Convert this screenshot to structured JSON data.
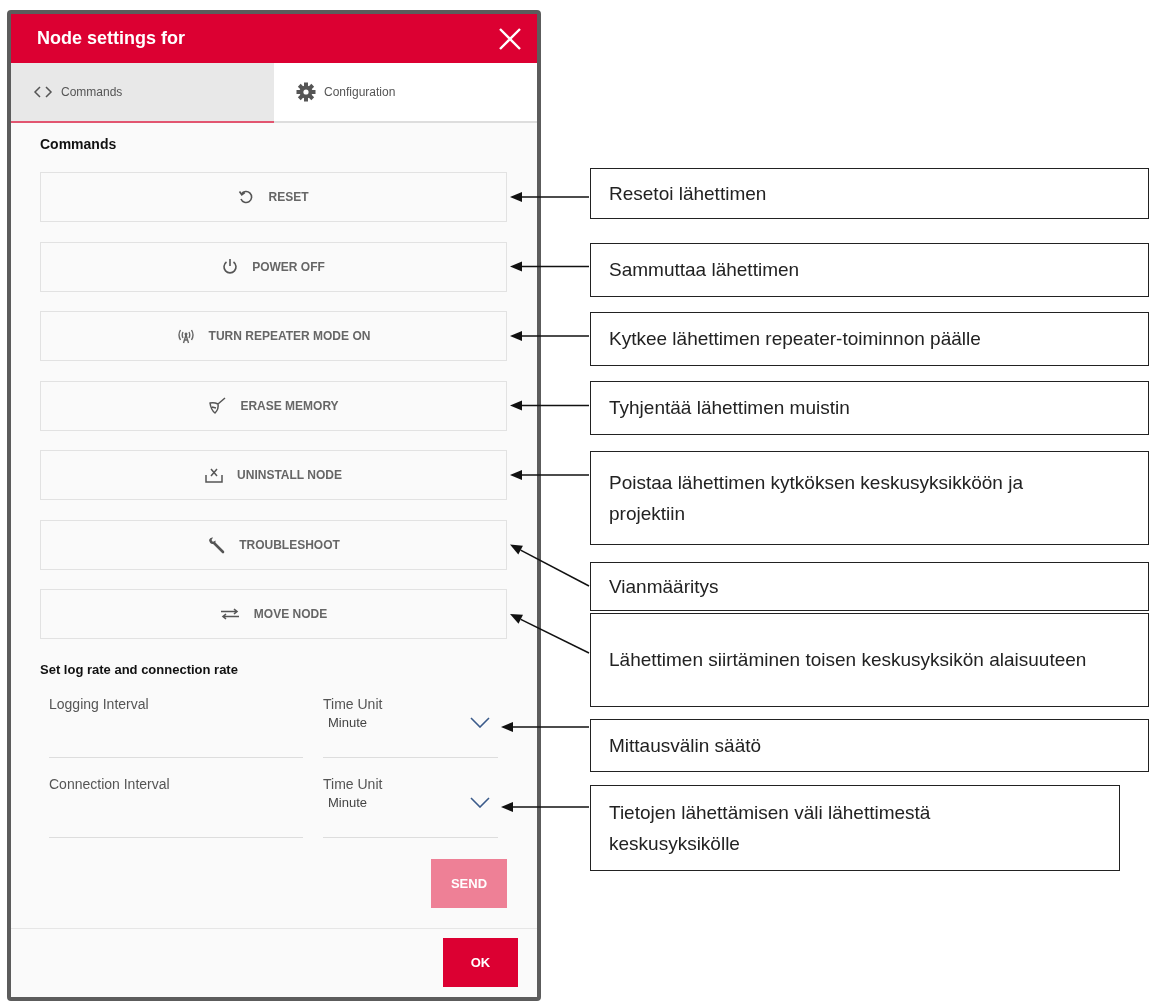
{
  "dialog": {
    "title": "Node settings for",
    "tabs": [
      {
        "label": "Commands",
        "kind": "code",
        "selected": true
      },
      {
        "label": "Configuration",
        "kind": "gear",
        "selected": false
      }
    ],
    "section_title": "Commands",
    "commands": [
      {
        "label": "RESET",
        "kind": "reset"
      },
      {
        "label": "POWER OFF",
        "kind": "power"
      },
      {
        "label": "TURN REPEATER MODE ON",
        "kind": "antenna"
      },
      {
        "label": "ERASE MEMORY",
        "kind": "erase"
      },
      {
        "label": "UNINSTALL NODE",
        "kind": "uninstall"
      },
      {
        "label": "TROUBLESHOOT",
        "kind": "wrench"
      },
      {
        "label": "MOVE NODE",
        "kind": "swap"
      }
    ],
    "rate_section_title": "Set log rate and connection rate",
    "intervals": [
      {
        "label": "Logging Interval",
        "unit_label": "Time Unit",
        "unit_value": "Minute"
      },
      {
        "label": "Connection Interval",
        "unit_label": "Time Unit",
        "unit_value": "Minute"
      }
    ],
    "send_button": {
      "label": "SEND",
      "disabled": true
    },
    "ok_button": {
      "label": "OK"
    }
  },
  "callouts": [
    {
      "text": "Resetoi lähettimen"
    },
    {
      "text": "Sammuttaa lähettimen"
    },
    {
      "text": "Kytkee lähettimen repeater-toiminnon päälle"
    },
    {
      "text": "Tyhjentää lähettimen muistin"
    },
    {
      "text": "Poistaa lähettimen kytköksen keskusyksikköön ja projektiin"
    },
    {
      "text": "Vianmääritys"
    },
    {
      "text": "Lähettimen siirtäminen toisen keskusyksikön alaisuuteen"
    },
    {
      "text": "Mittausvälin säätö"
    },
    {
      "text": "Tietojen lähettämisen väli lähettimestä keskusyksikölle"
    }
  ]
}
